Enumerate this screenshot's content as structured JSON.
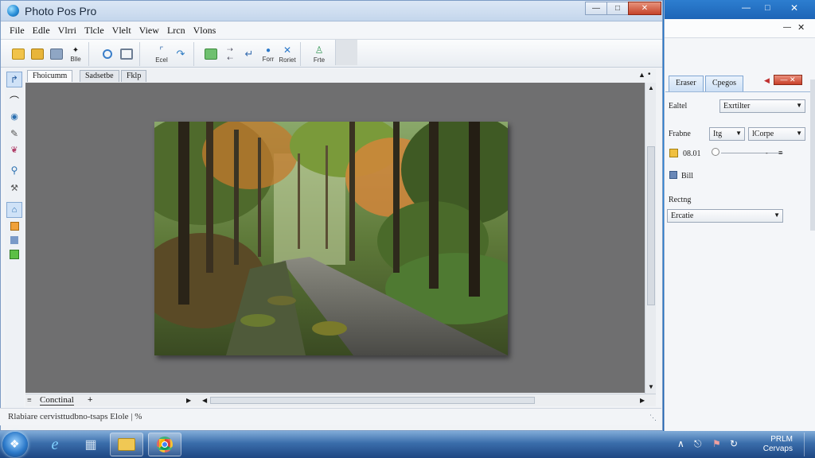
{
  "app": {
    "title": "Photo Pos Pro"
  },
  "menu": [
    "File",
    "Edle",
    "Vlrri",
    "Tlcle",
    "Vlelt",
    "View",
    "Lrcn",
    "Vlons"
  ],
  "toolbar": {
    "labels": [
      "Blle",
      "Ecel",
      "Forr",
      "Roriet",
      "Frte"
    ]
  },
  "doc_tabs": [
    "Fhoicumm",
    "Sadsetbe",
    "Fklp"
  ],
  "canvas": {
    "tab_name": "Conctinal"
  },
  "status": {
    "text": "Rlabiare cervisttudbno-tsaps  Elole  | %"
  },
  "panel": {
    "tabs": [
      "Eraser",
      "Cpegos"
    ],
    "fields": {
      "label1": "Ealtel",
      "combo1": "Exrtilter",
      "label2": "Frabne",
      "combo2a": "Itg",
      "combo2b": "lCorpe",
      "value": "08.01",
      "item": "Bill",
      "label3": "Rectng",
      "combo3": "Ercatie"
    }
  },
  "tray": {
    "clock_line1": "PRLM",
    "clock_line2": "Cervaps"
  },
  "colors": {
    "titlebar": "#c4d6ec",
    "canvas": "#6f6f70",
    "panel_tab": "#cde0f5",
    "taskbar": "#1d64b6"
  }
}
